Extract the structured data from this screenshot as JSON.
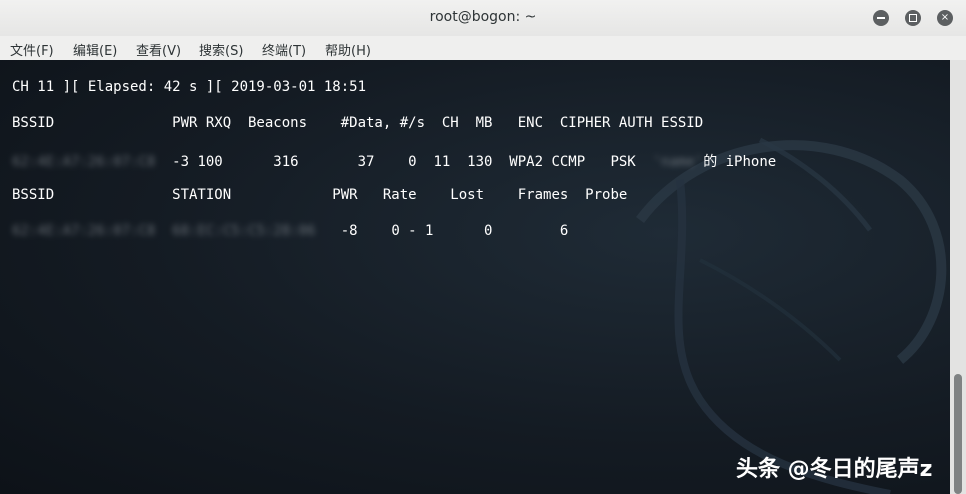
{
  "window": {
    "title": "root@bogon: ~",
    "buttons": {
      "minimize": "minimize-icon",
      "maximize": "maximize-icon",
      "close": "×"
    }
  },
  "menu": [
    "文件(F)",
    "编辑(E)",
    "查看(V)",
    "搜索(S)",
    "终端(T)",
    "帮助(H)"
  ],
  "terminal": {
    "status_line": "CH 11 ][ Elapsed: 42 s ][ 2019-03-01 18:51",
    "ap_header": "BSSID              PWR RXQ  Beacons    #Data, #/s  CH  MB   ENC  CIPHER AUTH ESSID",
    "ap_row": {
      "bssid": "62:4E:A7:26:07:C8",
      "stats": "-3 100      316       37    0  11  130  WPA2 CCMP   PSK",
      "essid_blurred": "'name'",
      "essid_suffix": "的 iPhone"
    },
    "sta_header": "BSSID              STATION            PWR   Rate    Lost    Frames  Probe",
    "sta_row": {
      "bssid": "62:4E:A7:26:07:C8",
      "station": "68:EC:C5:C5:28:06",
      "stats": "-8    0 - 1      0        6"
    }
  },
  "watermark": "头条 @冬日的尾声z",
  "colors": {
    "terminal_bg": "#141b23",
    "text": "#ffffff",
    "titlebar": "#efefee"
  }
}
